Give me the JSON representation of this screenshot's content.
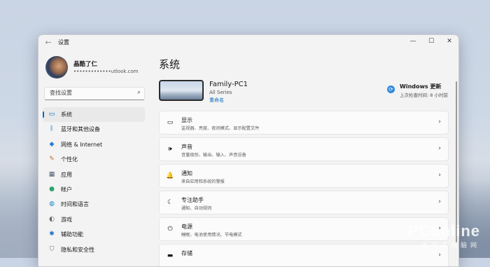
{
  "window": {
    "title": "设置",
    "controls": [
      "—",
      "☐",
      "✕"
    ]
  },
  "user": {
    "name": "晶酷了仁",
    "email": "•••••••••••••utlook.com"
  },
  "search": {
    "placeholder": "查找设置"
  },
  "nav": [
    {
      "label": "系统",
      "icon": "system-monitor-icon",
      "glyph": "▭",
      "color": "#0067c0",
      "active": true
    },
    {
      "label": "蓝牙和其他设备",
      "icon": "bluetooth-icon",
      "glyph": "ᛒ",
      "color": "#0067c0"
    },
    {
      "label": "网络 & Internet",
      "icon": "wifi-icon",
      "glyph": "◆",
      "color": "#1f7ed6"
    },
    {
      "label": "个性化",
      "icon": "brush-icon",
      "glyph": "✎",
      "color": "#c56a2a"
    },
    {
      "label": "应用",
      "icon": "apps-icon",
      "glyph": "▦",
      "color": "#4a5a72"
    },
    {
      "label": "帐户",
      "icon": "account-icon",
      "glyph": "●",
      "color": "#2fa36b"
    },
    {
      "label": "时间和语言",
      "icon": "globe-clock-icon",
      "glyph": "◍",
      "color": "#1a8ad0"
    },
    {
      "label": "游戏",
      "icon": "gamepad-icon",
      "glyph": "◐",
      "color": "#6a6a6a"
    },
    {
      "label": "辅助功能",
      "icon": "accessibility-icon",
      "glyph": "✱",
      "color": "#1a73c9"
    },
    {
      "label": "隐私和安全性",
      "icon": "shield-icon",
      "glyph": "⛉",
      "color": "#6a6f78"
    }
  ],
  "main": {
    "title": "系统",
    "device": {
      "name": "Family-PC1",
      "model": "All Series",
      "rename": "重命名"
    },
    "windows_update": {
      "title": "Windows 更新",
      "subtitle": "上次检查时间: 8 小时前"
    },
    "cards": [
      {
        "title": "显示",
        "desc": "监视器、亮度、夜间模式、显示配置文件",
        "icon": "display-icon",
        "glyph": "▭"
      },
      {
        "title": "声音",
        "desc": "音量级别、输出、输入、声音设备",
        "icon": "speaker-icon",
        "glyph": "🕪"
      },
      {
        "title": "通知",
        "desc": "来自应用和系统的警报",
        "icon": "bell-icon",
        "glyph": "🔔"
      },
      {
        "title": "专注助手",
        "desc": "通知、自动规则",
        "icon": "moon-icon",
        "glyph": "☾"
      },
      {
        "title": "电源",
        "desc": "睡眠、电池使用情况、节电模式",
        "icon": "power-icon",
        "glyph": "⏻"
      },
      {
        "title": "存储",
        "desc": "",
        "icon": "storage-icon",
        "glyph": "▬"
      }
    ]
  },
  "watermark": {
    "brand": "PConline",
    "sub": "太平洋电脑网"
  }
}
